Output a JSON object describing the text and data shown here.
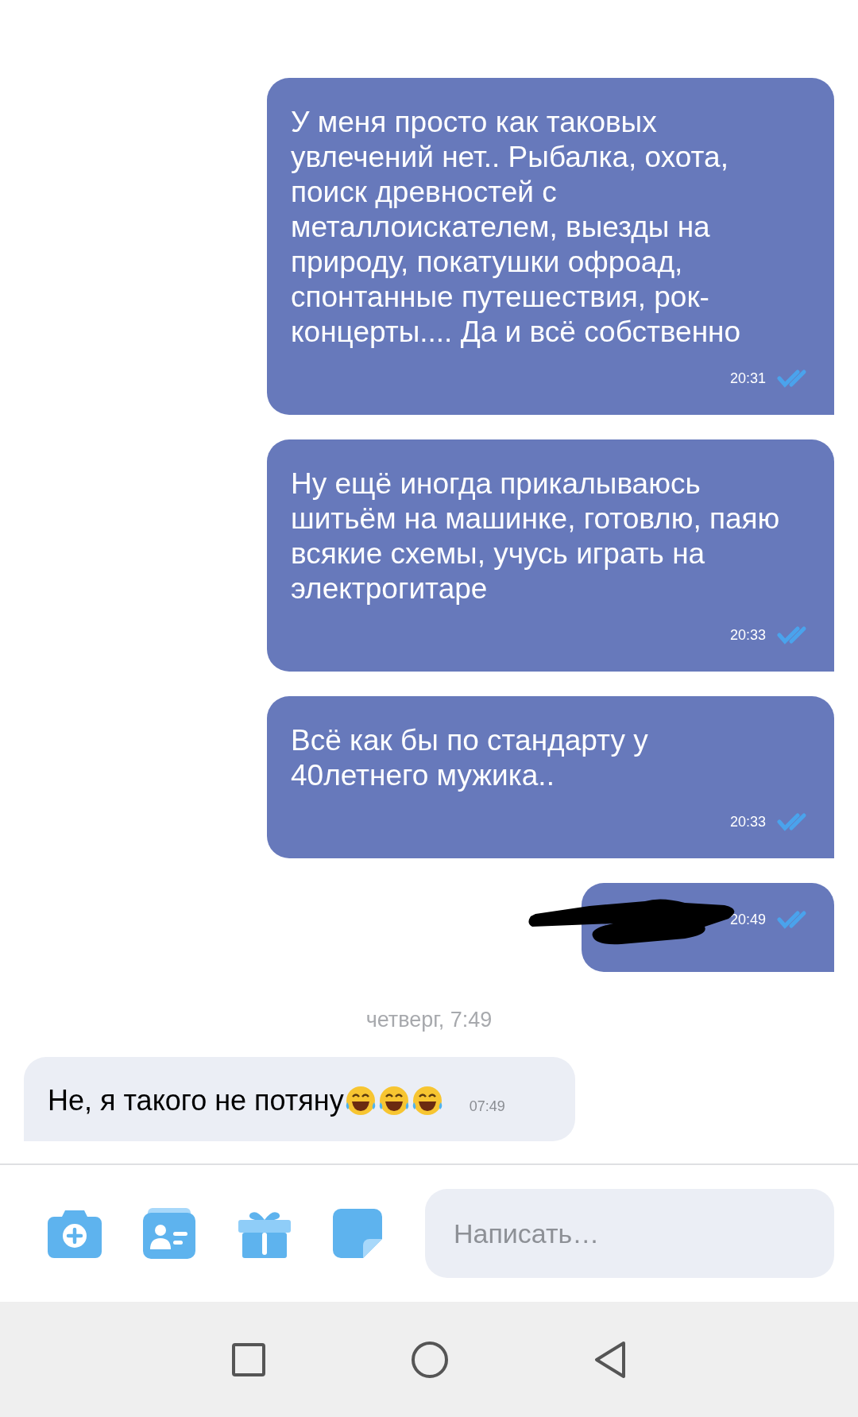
{
  "messages": [
    {
      "kind": "outgoing",
      "text": "У меня просто как таковых увлечений нет.. Рыбалка, охота, поиск древностей с металлоискателем, выезды на природу, покатушки офроад, спонтанные путешествия, рок-концерты.... Да и всё собственно",
      "time": "20:31",
      "read": true
    },
    {
      "kind": "outgoing",
      "text": "Ну ещё иногда прикалываюсь шитьём на машинке, готовлю, паяю всякие схемы, учусь играть на электрогитаре",
      "time": "20:33",
      "read": true
    },
    {
      "kind": "outgoing",
      "text": "Всё как бы по стандарту у 40летнего мужика..",
      "time": "20:33",
      "read": true
    },
    {
      "kind": "redacted",
      "time": "20:49",
      "read": true
    },
    {
      "kind": "date",
      "text": "четверг, 7:49"
    },
    {
      "kind": "incoming",
      "text": "Не, я такого не потяну",
      "emojis": [
        {
          "kind": "laughing"
        },
        {
          "kind": "laughing"
        },
        {
          "kind": "laughing"
        }
      ],
      "time": "07:49"
    }
  ],
  "composer": {
    "placeholder": "Написать…"
  }
}
